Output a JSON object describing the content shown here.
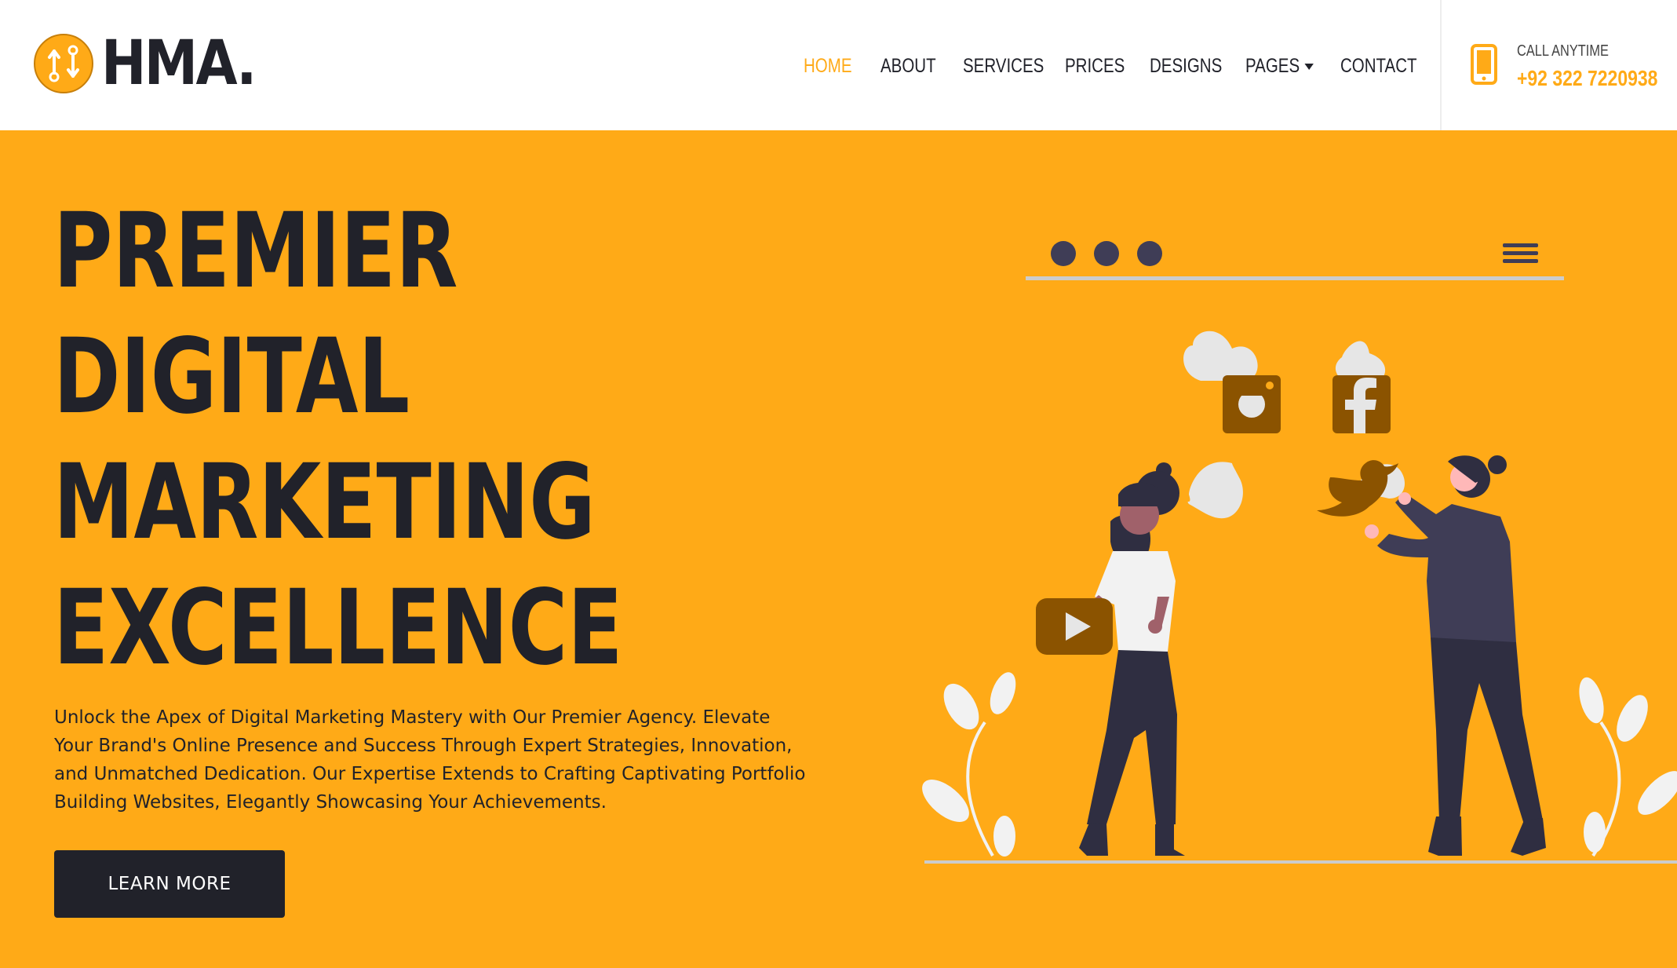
{
  "brand": {
    "name": "HMA."
  },
  "nav": {
    "items": [
      {
        "label": "HOME",
        "active": true
      },
      {
        "label": "ABOUT"
      },
      {
        "label": "SERVICES"
      },
      {
        "label": "PRICES"
      },
      {
        "label": "DESIGNS"
      },
      {
        "label": "PAGES",
        "dropdown": true
      },
      {
        "label": "CONTACT"
      }
    ]
  },
  "contact": {
    "label": "CALL ANYTIME",
    "phone": "+92 322 7220938"
  },
  "hero": {
    "title_lines": [
      "PREMIER",
      "DIGITAL",
      "MARKETING",
      "EXCELLENCE"
    ],
    "description": "Unlock the Apex of Digital Marketing Mastery with Our Premier Agency. Elevate Your Brand's Online Presence and Success Through Expert Strategies, Innovation, and Unmatched Dedication. Our Expertise Extends to Crafting Captivating Portfolio Building Websites, Elegantly Showcasing Your Achievements.",
    "cta_label": "LEARN MORE"
  },
  "colors": {
    "accent": "#ffaa17",
    "dark": "#21222a",
    "icon_brown": "#8b5300",
    "blob": "#e6e6e6"
  },
  "illustration": {
    "icons": [
      "instagram-icon",
      "facebook-icon",
      "twitter-icon",
      "youtube-icon",
      "hamburger-menu-icon"
    ]
  }
}
